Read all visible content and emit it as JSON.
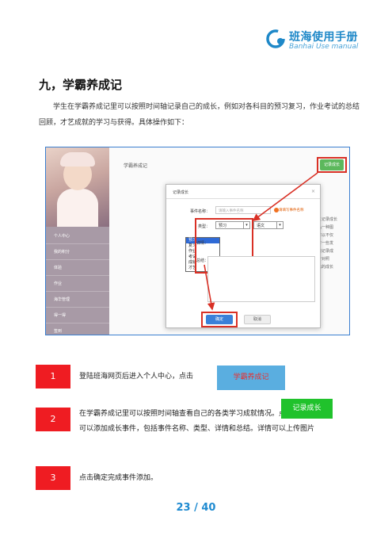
{
  "brand": {
    "name": "班海使用手册",
    "subtitle": "Banhai Use manual",
    "logo_icon": "c-ring-logo-icon",
    "color": "#1e88c8"
  },
  "section": {
    "title": "九，学霸养成记",
    "intro": "学生在学霸养成记里可以按照时间轴记录自己的成长，例如对各科目的预习复习，作业考试的总结回顾，才艺成就的学习与获得。具体操作如下："
  },
  "screenshot": {
    "sidebar_items": [
      "个人中心",
      "我的积分",
      "体验",
      "作业",
      "海华管理",
      "得一得",
      "签到"
    ],
    "main_title": "学霸养成记",
    "record_button": "记录成长",
    "right_text": [
      "可以记录成长",
      "作品一种图",
      "你可以不仅",
      "也可一些发",
      "书籍记录成",
      "关于对照",
      "自己的成长"
    ],
    "dialog": {
      "title": "记录成长",
      "event_name_label": "事件名称：",
      "event_name_placeholder": "请输入事件名称",
      "warning": "请填写事件名称",
      "type_label": "类型：",
      "type_value": "预习",
      "subject_value": "语文",
      "detail_label": "详情：",
      "summary_label": "总结：",
      "type_options": [
        "预习",
        "复习",
        "作业",
        "考试",
        "成就",
        "才艺"
      ],
      "ok_button": "确定",
      "cancel_button": "取消"
    }
  },
  "steps": [
    {
      "num": "1",
      "text": "登陆班海网页后进入个人中心，点击"
    },
    {
      "num": "2",
      "text_line1": "在学霸养成记里可以按照时间轴查看自己的各类学习成就情况。点击",
      "text_line2": "可以添加成长事件，包括事件名称、类型、详情和总结。详情可以上传图片"
    },
    {
      "num": "3",
      "text": "点击确定完成事件添加。"
    }
  ],
  "buttons": {
    "xueba_label": "学霸养成记",
    "record_growth_label": "记录成长"
  },
  "page_number": "23 / 40",
  "colors": {
    "step_red": "#ef1c22",
    "blue_pill": "#5aaee0",
    "green_pill": "#20c22c",
    "page_num": "#1e8ad0"
  }
}
